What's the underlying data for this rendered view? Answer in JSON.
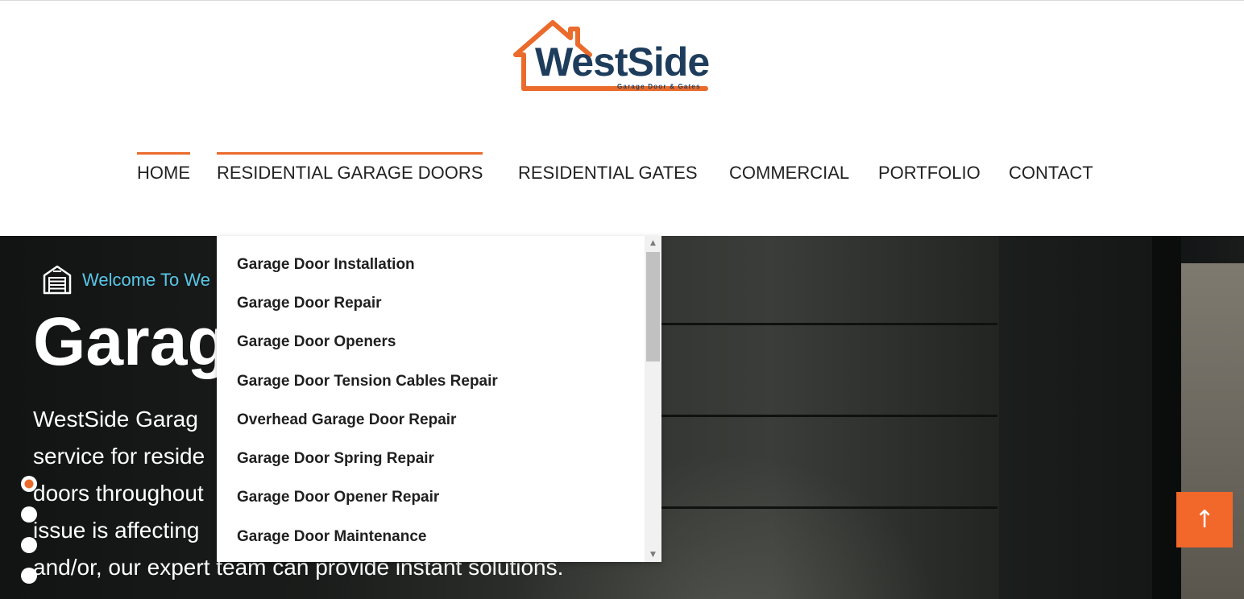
{
  "brand": {
    "name": "WestSide",
    "tagline": "Garage Door & Gates",
    "house_color": "#ea6b2c",
    "text_color": "#1e3d5c"
  },
  "nav": {
    "items": [
      {
        "label": "HOME",
        "active": true
      },
      {
        "label": "RESIDENTIAL GARAGE DOORS",
        "active": true
      },
      {
        "label": "RESIDENTIAL GATES",
        "active": false
      },
      {
        "label": "COMMERCIAL",
        "active": false
      },
      {
        "label": "PORTFOLIO",
        "active": false
      },
      {
        "label": "CONTACT",
        "active": false
      }
    ],
    "accent_color": "#ea6b2c"
  },
  "dropdown": {
    "items": [
      "Garage Door Installation",
      "Garage Door Repair",
      "Garage Door Openers",
      "Garage Door Tension Cables Repair",
      "Overhead Garage Door Repair",
      "Garage Door Spring Repair",
      "Garage Door Opener Repair",
      "Garage Door Maintenance"
    ],
    "scroll_up_icon": "triangle-up",
    "scroll_down_icon": "triangle-down"
  },
  "hero": {
    "welcome_icon": "garage-icon",
    "welcome_text": "Welcome To We",
    "title": "Garag",
    "description_lines": [
      "WestSide Garag",
      "service for reside",
      "doors throughout",
      "issue is affecting",
      "and/or, our expert team can provide instant solutions."
    ],
    "welcome_color": "#58c7e8",
    "slider_dots": 4,
    "active_dot": 0
  },
  "back_to_top": {
    "icon": "arrow-up-icon",
    "color": "#f2672a"
  }
}
